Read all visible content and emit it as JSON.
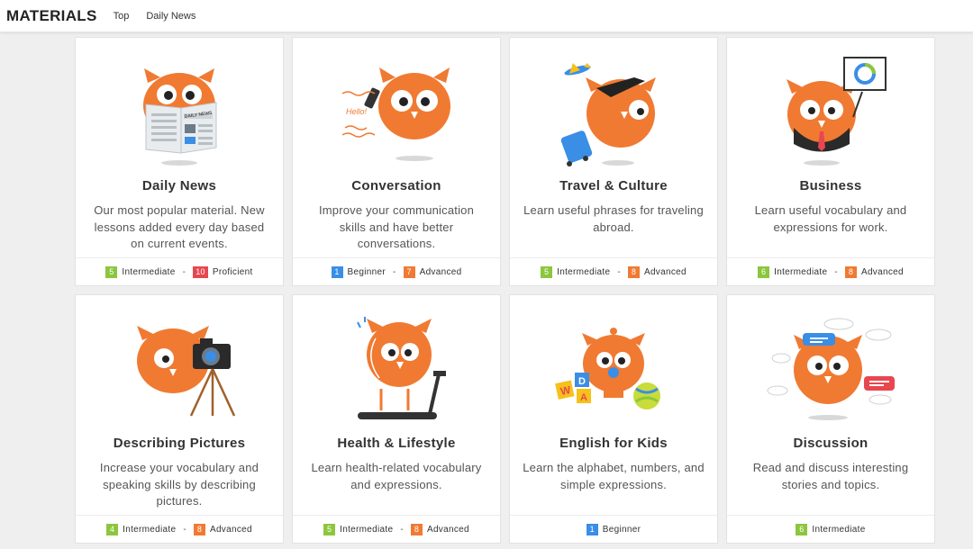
{
  "header": {
    "brand": "MATERIALS",
    "nav": [
      {
        "label": "Top"
      },
      {
        "label": "Daily News"
      }
    ]
  },
  "colors": {
    "owl_orange": "#f07a32",
    "intermediate": "#8cc63f",
    "proficient": "#e8474f",
    "beginner": "#3a8ee6",
    "advanced": "#f07a32"
  },
  "cards": [
    {
      "title": "Daily News",
      "desc": "Our most popular material. New lessons added every day based on current events.",
      "illustration": "owl-reading-newspaper",
      "newspaper_text": "DAILY NEWS",
      "levels": [
        {
          "num": "5",
          "label": "Intermediate",
          "color": "#8cc63f"
        },
        {
          "num": "10",
          "label": "Proficient",
          "color": "#e8474f"
        }
      ]
    },
    {
      "title": "Conversation",
      "desc": "Improve your communication skills and have better conversations.",
      "illustration": "owl-on-phone",
      "bubble_text": "Hello!",
      "levels": [
        {
          "num": "1",
          "label": "Beginner",
          "color": "#3a8ee6"
        },
        {
          "num": "7",
          "label": "Advanced",
          "color": "#f07a32"
        }
      ]
    },
    {
      "title": "Travel & Culture",
      "desc": "Learn useful phrases for traveling abroad.",
      "illustration": "owl-with-sunglasses-and-suitcase",
      "levels": [
        {
          "num": "5",
          "label": "Intermediate",
          "color": "#8cc63f"
        },
        {
          "num": "8",
          "label": "Advanced",
          "color": "#f07a32"
        }
      ]
    },
    {
      "title": "Business",
      "desc": "Learn useful vocabulary and expressions for work.",
      "illustration": "owl-in-suit-with-chart",
      "levels": [
        {
          "num": "6",
          "label": "Intermediate",
          "color": "#8cc63f"
        },
        {
          "num": "8",
          "label": "Advanced",
          "color": "#f07a32"
        }
      ]
    },
    {
      "title": "Describing Pictures",
      "desc": "Increase your vocabulary and speaking skills by describing pictures.",
      "illustration": "owl-with-camera-tripod",
      "levels": [
        {
          "num": "4",
          "label": "Intermediate",
          "color": "#8cc63f"
        },
        {
          "num": "8",
          "label": "Advanced",
          "color": "#f07a32"
        }
      ]
    },
    {
      "title": "Health & Lifestyle",
      "desc": "Learn health-related vocabulary and expressions.",
      "illustration": "owl-on-treadmill",
      "levels": [
        {
          "num": "5",
          "label": "Intermediate",
          "color": "#8cc63f"
        },
        {
          "num": "8",
          "label": "Advanced",
          "color": "#f07a32"
        }
      ]
    },
    {
      "title": "English for Kids",
      "desc": "Learn the alphabet, numbers, and simple expressions.",
      "illustration": "baby-owl-with-blocks",
      "block_letters": [
        "W",
        "D",
        "A"
      ],
      "levels": [
        {
          "num": "1",
          "label": "Beginner",
          "color": "#3a8ee6"
        }
      ]
    },
    {
      "title": "Discussion",
      "desc": "Read and discuss interesting stories and topics.",
      "illustration": "owl-with-speech-bubbles",
      "levels": [
        {
          "num": "6",
          "label": "Intermediate",
          "color": "#8cc63f"
        }
      ]
    }
  ]
}
